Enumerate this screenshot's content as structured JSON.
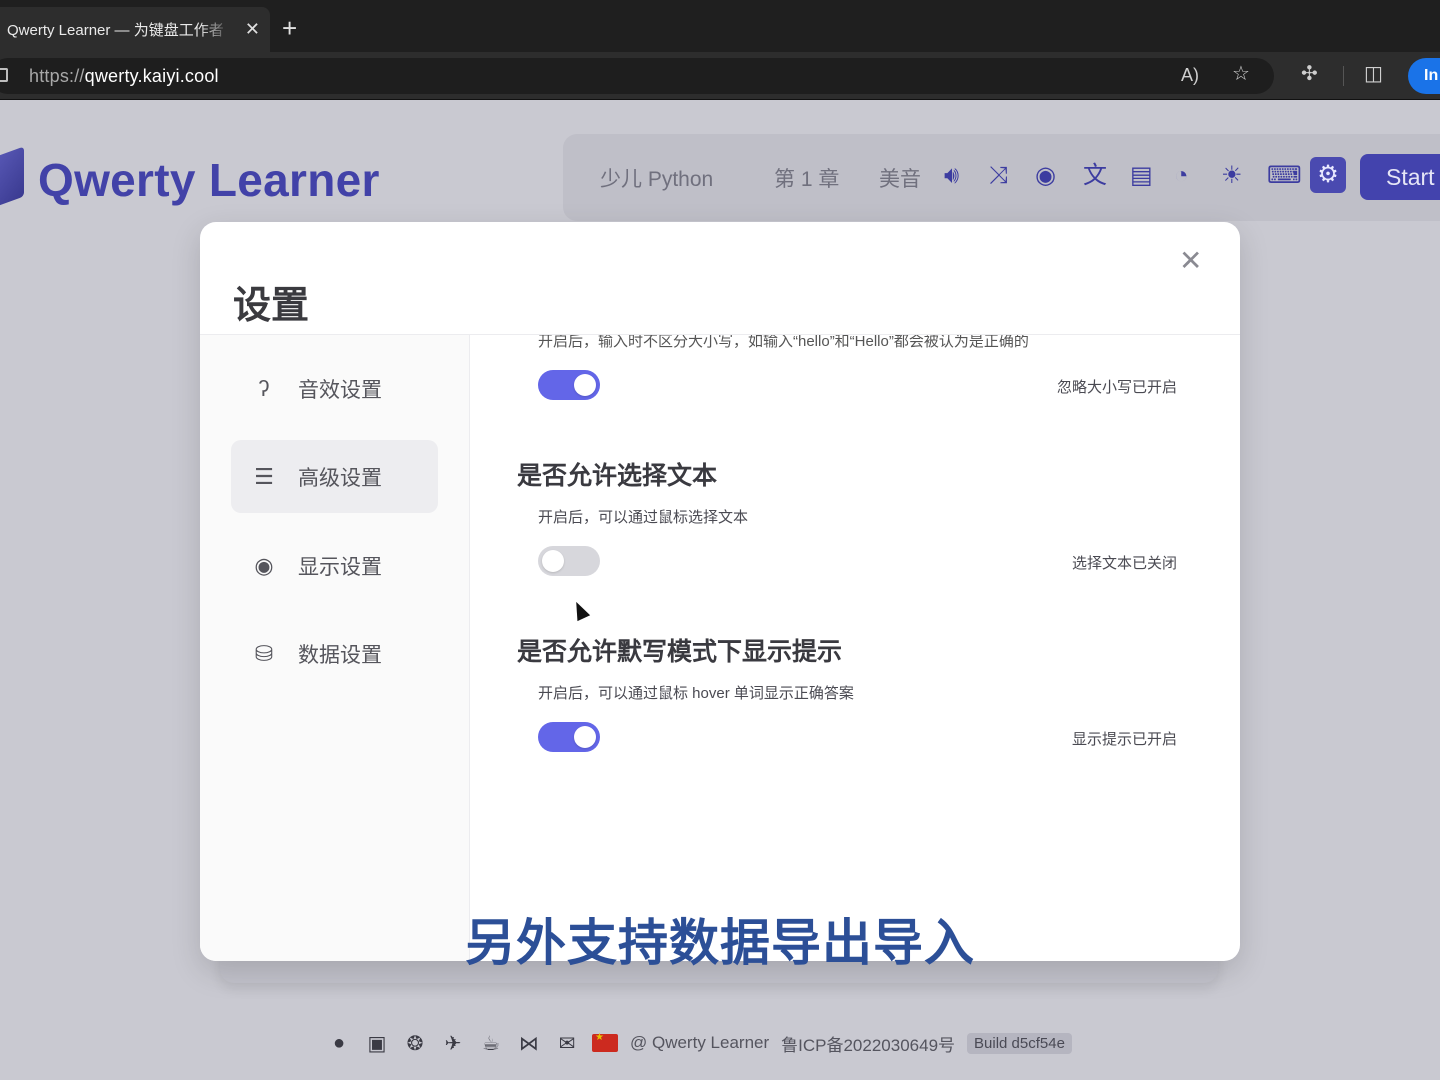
{
  "browser": {
    "tab_title": "Qwerty Learner — 为键盘工作者",
    "tab_close": "✕",
    "new_tab": "+",
    "url_scheme": "https://",
    "url_host": "qwerty.kaiyi.cool",
    "signin_label": "In"
  },
  "header": {
    "brand": "Qwerty Learner",
    "dictionary": "少儿 Python",
    "chapter": "第 1 章",
    "pronunciation": "美音",
    "start_label": "Start"
  },
  "modal": {
    "title": "设置",
    "close": "✕",
    "nav": [
      {
        "label": "音效设置",
        "icon": "ear-icon"
      },
      {
        "label": "高级设置",
        "icon": "sliders-icon"
      },
      {
        "label": "显示设置",
        "icon": "eye-icon"
      },
      {
        "label": "数据设置",
        "icon": "database-gear-icon"
      }
    ],
    "active_nav": 1,
    "clipped_desc": "开启后，输入时不区分大小写，如输入“hello”和“Hello”都会被认为是正确的",
    "ignore_case": {
      "enabled": true,
      "status": "忽略大小写已开启"
    },
    "select_text": {
      "title": "是否允许选择文本",
      "desc": "开启后，可以通过鼠标选择文本",
      "enabled": false,
      "status": "选择文本已关闭"
    },
    "dictation_hint": {
      "title": "是否允许默写模式下显示提示",
      "desc": "开启后，可以通过鼠标 hover 单词显示正确答案",
      "enabled": true,
      "status": "显示提示已开启"
    }
  },
  "footer": {
    "copyright": "@ Qwerty Learner",
    "icp": "鲁ICP备2022030649号",
    "build": "Build d5cf54e"
  },
  "caption": "另外支持数据导出导入",
  "colors": {
    "accent": "#6366e8",
    "brand": "#4242a8",
    "caption": "#2c4f97"
  }
}
